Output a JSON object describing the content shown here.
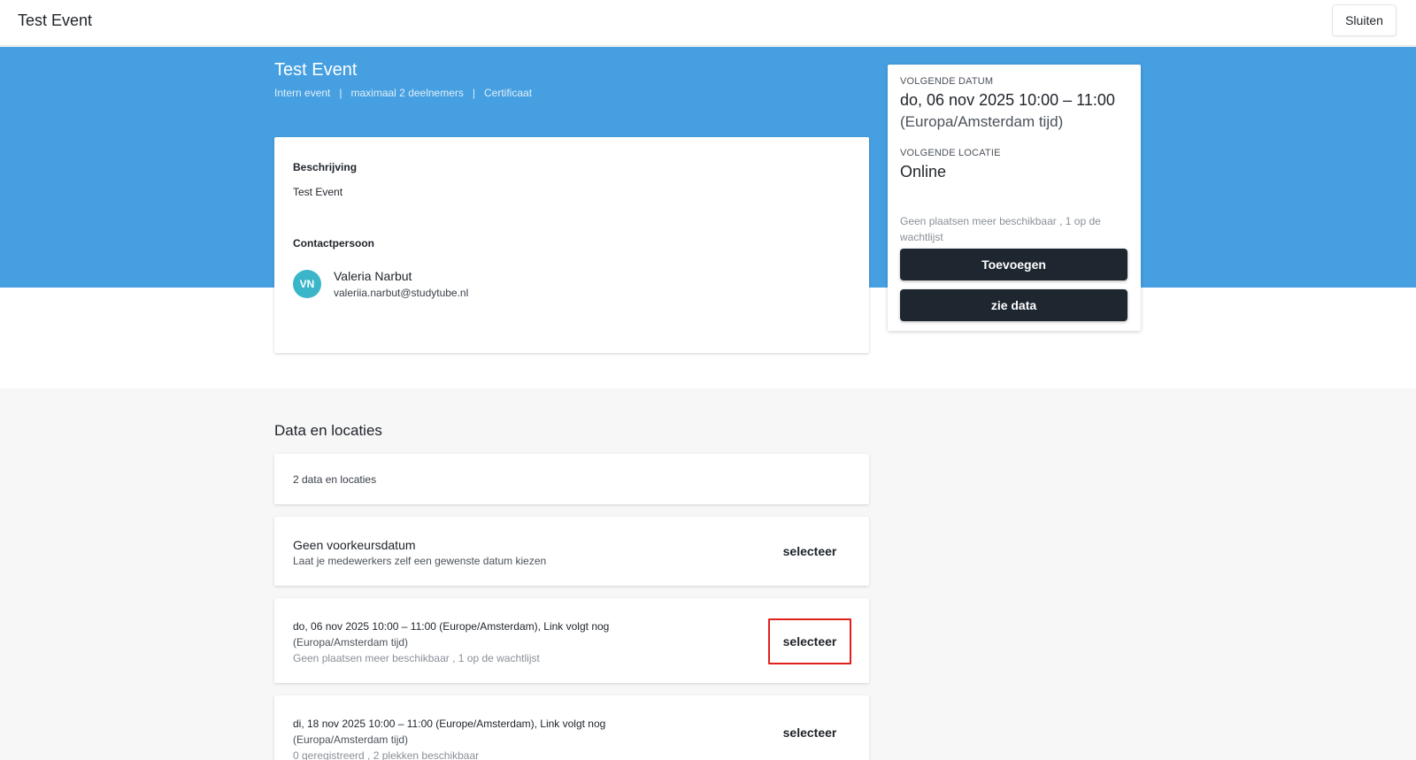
{
  "topbar": {
    "title": "Test Event",
    "close_label": "Sluiten"
  },
  "event": {
    "title": "Test Event",
    "meta": [
      "Intern event",
      "maximaal 2 deelnemers",
      "Certificaat"
    ],
    "meta_separator": "|"
  },
  "description": {
    "label": "Beschrijving",
    "text": "Test Event",
    "contact_label": "Contactpersoon",
    "contact": {
      "initials": "VN",
      "name": "Valeria Narbut",
      "email": "valeriia.narbut@studytube.nl"
    }
  },
  "side": {
    "next_date_label": "VOLGENDE DATUM",
    "next_date": "do, 06 nov 2025 10:00 – 11:00",
    "timezone": "(Europa/Amsterdam tijd)",
    "next_location_label": "VOLGENDE LOCATIE",
    "next_location": "Online",
    "availability": "Geen plaatsen meer beschikbaar , 1 op de wachtlijst",
    "add_button": "Toevoegen",
    "dates_button": "zie data"
  },
  "dates": {
    "section_title": "Data en locaties",
    "count": "2 data en locaties",
    "rows": [
      {
        "line1": "Geen voorkeursdatum",
        "line2": "Laat je medewerkers zelf een gewenste datum kiezen",
        "line3": "",
        "button": "selecteer"
      },
      {
        "line1": "do, 06 nov 2025 10:00 – 11:00 (Europe/Amsterdam), Link volgt nog",
        "line2": "(Europa/Amsterdam tijd)",
        "line3": "Geen plaatsen meer beschikbaar , 1 op de wachtlijst",
        "button": "selecteer"
      },
      {
        "line1": "di, 18 nov 2025 10:00 – 11:00 (Europe/Amsterdam), Link volgt nog",
        "line2": "(Europa/Amsterdam tijd)",
        "line3": "0 geregistreerd , 2 plekken beschikbaar",
        "button": "selecteer"
      }
    ]
  },
  "colors": {
    "hero": "#459fe0",
    "dark_button": "#1e2730",
    "avatar": "#3bb6c9",
    "highlight": "#e0201b"
  }
}
